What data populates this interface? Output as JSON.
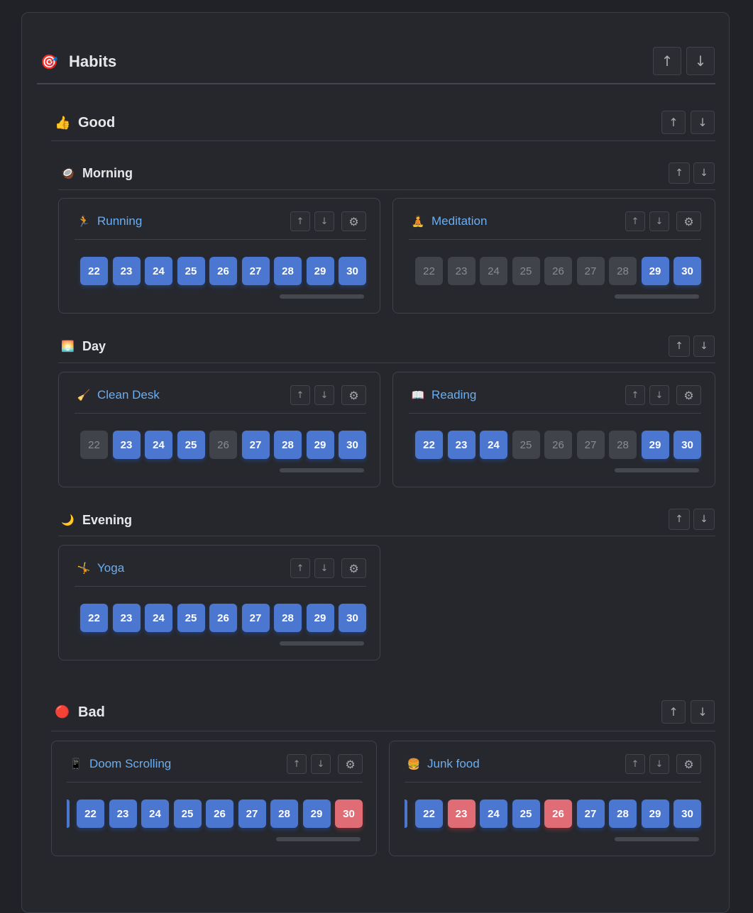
{
  "page": {
    "title": "Habits",
    "icon": "🎯",
    "up": "↑",
    "down": "↓",
    "settings": "⚙"
  },
  "groups": {
    "good": {
      "label": "Good",
      "icon": "👍",
      "sections": {
        "morning": {
          "label": "Morning",
          "icon": "🥥",
          "habits": [
            {
              "name": "Running",
              "icon": "🏃",
              "days": [
                {
                  "n": "22",
                  "s": "on"
                },
                {
                  "n": "23",
                  "s": "on"
                },
                {
                  "n": "24",
                  "s": "on"
                },
                {
                  "n": "25",
                  "s": "on"
                },
                {
                  "n": "26",
                  "s": "on"
                },
                {
                  "n": "27",
                  "s": "on"
                },
                {
                  "n": "28",
                  "s": "on"
                },
                {
                  "n": "29",
                  "s": "on"
                },
                {
                  "n": "30",
                  "s": "on"
                }
              ]
            },
            {
              "name": "Meditation",
              "icon": "🧘",
              "days": [
                {
                  "n": "22",
                  "s": "off"
                },
                {
                  "n": "23",
                  "s": "off"
                },
                {
                  "n": "24",
                  "s": "off"
                },
                {
                  "n": "25",
                  "s": "off"
                },
                {
                  "n": "26",
                  "s": "off"
                },
                {
                  "n": "27",
                  "s": "off"
                },
                {
                  "n": "28",
                  "s": "off"
                },
                {
                  "n": "29",
                  "s": "on"
                },
                {
                  "n": "30",
                  "s": "on"
                }
              ]
            }
          ]
        },
        "day": {
          "label": "Day",
          "icon": "🌅",
          "habits": [
            {
              "name": "Clean Desk",
              "icon": "🧹",
              "days": [
                {
                  "n": "22",
                  "s": "off"
                },
                {
                  "n": "23",
                  "s": "on"
                },
                {
                  "n": "24",
                  "s": "on"
                },
                {
                  "n": "25",
                  "s": "on"
                },
                {
                  "n": "26",
                  "s": "off"
                },
                {
                  "n": "27",
                  "s": "on"
                },
                {
                  "n": "28",
                  "s": "on"
                },
                {
                  "n": "29",
                  "s": "on"
                },
                {
                  "n": "30",
                  "s": "on"
                }
              ]
            },
            {
              "name": "Reading",
              "icon": "📖",
              "days": [
                {
                  "n": "22",
                  "s": "on"
                },
                {
                  "n": "23",
                  "s": "on"
                },
                {
                  "n": "24",
                  "s": "on"
                },
                {
                  "n": "25",
                  "s": "off"
                },
                {
                  "n": "26",
                  "s": "off"
                },
                {
                  "n": "27",
                  "s": "off"
                },
                {
                  "n": "28",
                  "s": "off"
                },
                {
                  "n": "29",
                  "s": "on"
                },
                {
                  "n": "30",
                  "s": "on"
                }
              ]
            }
          ]
        },
        "evening": {
          "label": "Evening",
          "icon": "🌙",
          "habits": [
            {
              "name": "Yoga",
              "icon": "🤸",
              "days": [
                {
                  "n": "22",
                  "s": "on"
                },
                {
                  "n": "23",
                  "s": "on"
                },
                {
                  "n": "24",
                  "s": "on"
                },
                {
                  "n": "25",
                  "s": "on"
                },
                {
                  "n": "26",
                  "s": "on"
                },
                {
                  "n": "27",
                  "s": "on"
                },
                {
                  "n": "28",
                  "s": "on"
                },
                {
                  "n": "29",
                  "s": "on"
                },
                {
                  "n": "30",
                  "s": "on"
                }
              ]
            }
          ]
        }
      }
    },
    "bad": {
      "label": "Bad",
      "icon": "🔴",
      "habits": [
        {
          "name": "Doom Scrolling",
          "icon": "📱",
          "days": [
            {
              "n": "22",
              "s": "on"
            },
            {
              "n": "23",
              "s": "on"
            },
            {
              "n": "24",
              "s": "on"
            },
            {
              "n": "25",
              "s": "on"
            },
            {
              "n": "26",
              "s": "on"
            },
            {
              "n": "27",
              "s": "on"
            },
            {
              "n": "28",
              "s": "on"
            },
            {
              "n": "29",
              "s": "on"
            },
            {
              "n": "30",
              "s": "bad"
            }
          ]
        },
        {
          "name": "Junk food",
          "icon": "🍔",
          "days": [
            {
              "n": "22",
              "s": "on"
            },
            {
              "n": "23",
              "s": "bad"
            },
            {
              "n": "24",
              "s": "on"
            },
            {
              "n": "25",
              "s": "on"
            },
            {
              "n": "26",
              "s": "bad"
            },
            {
              "n": "27",
              "s": "on"
            },
            {
              "n": "28",
              "s": "on"
            },
            {
              "n": "29",
              "s": "on"
            },
            {
              "n": "30",
              "s": "on"
            }
          ]
        }
      ]
    }
  },
  "colors": {
    "done": "#4b77d1",
    "missed": "#40434a",
    "bad": "#e06c75",
    "link": "#6aaef2"
  }
}
